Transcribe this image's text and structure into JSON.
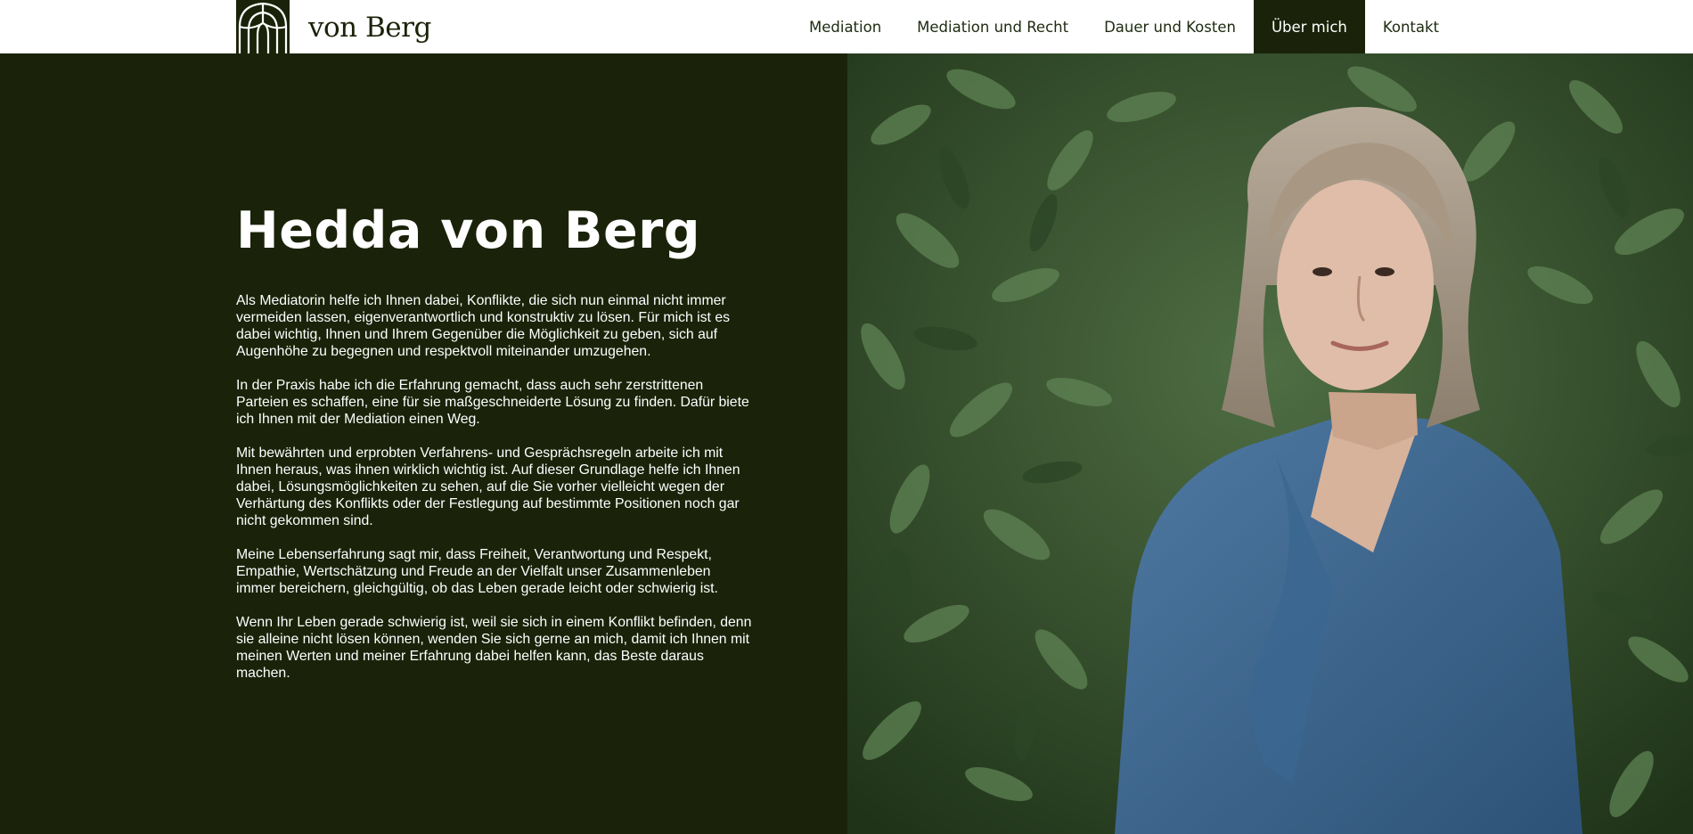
{
  "header": {
    "logo_icon": "arch-logo-icon",
    "logo_text": "von Berg",
    "nav": [
      {
        "label": "Mediation",
        "active": false
      },
      {
        "label": "Mediation und Recht",
        "active": false
      },
      {
        "label": "Dauer und Kosten",
        "active": false
      },
      {
        "label": "Über mich",
        "active": true
      },
      {
        "label": "Kontakt",
        "active": false
      }
    ]
  },
  "main": {
    "title": "Hedda von Berg",
    "paragraphs": [
      "Als Mediatorin helfe ich Ihnen dabei, Konflikte, die sich nun einmal nicht immer vermeiden lassen, eigenverantwortlich und konstruktiv zu lösen. Für mich ist es dabei wichtig, Ihnen und Ihrem Gegenüber die Möglichkeit zu geben, sich auf Augenhöhe zu begegnen und respektvoll miteinander umzugehen.",
      "In der Praxis habe ich die Erfahrung gemacht, dass auch sehr zerstrittenen Parteien es schaffen, eine für sie maßgeschneiderte Lösung zu finden. Dafür biete ich Ihnen mit der Mediation einen Weg.",
      "Mit bewährten und erprobten Verfahrens- und Gesprächsregeln arbeite ich mit Ihnen heraus, was ihnen wirklich wichtig ist. Auf dieser Grundlage helfe ich Ihnen dabei, Lösungsmöglichkeiten zu sehen, auf die Sie vorher vielleicht wegen der Verhärtung des Konflikts oder der Festlegung auf bestimmte Positionen noch gar nicht gekommen sind.",
      "Meine Lebenserfahrung sagt mir, dass Freiheit, Verantwortung und Respekt, Empathie, Wertschätzung und Freude an der Vielfalt unser Zusammenleben immer bereichern, gleichgültig, ob das Leben gerade leicht oder schwierig ist.",
      "Wenn Ihr Leben gerade schwierig ist, weil sie sich in einem Konflikt befinden, denn sie alleine nicht lösen können, wenden Sie sich gerne an mich, damit ich Ihnen mit meinen Werten und meiner Erfahrung dabei helfen kann, das Beste daraus machen."
    ]
  },
  "colors": {
    "brand_dark_green": "#1a2309",
    "header_bg": "#ffffff",
    "text_on_dark": "#ffffff"
  }
}
